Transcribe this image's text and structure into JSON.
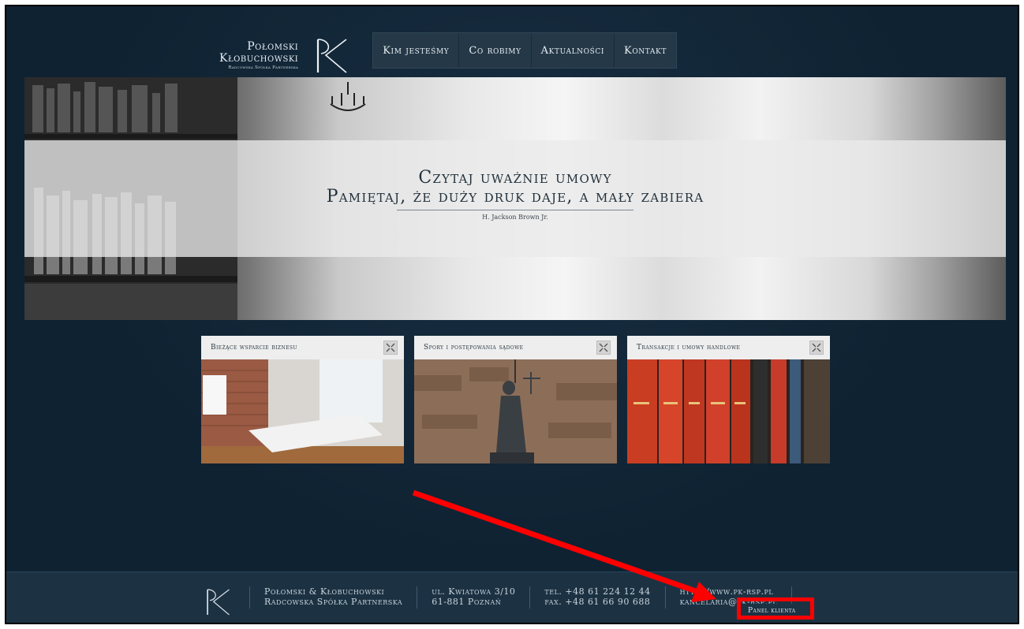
{
  "logo": {
    "line1": "Połomski",
    "line2": "Kłobuchowski",
    "line3": "Radcowska Spółka Partnerska",
    "mark_icon": "pk-monogram-icon"
  },
  "nav": {
    "items": [
      "Kim jesteśmy",
      "Co robimy",
      "Aktualności",
      "Kontakt"
    ]
  },
  "hero": {
    "quote_line1": "Czytaj uważnie umowy",
    "quote_line2": "Pamiętaj, że duży druk daje, a mały zabiera",
    "author": "H. Jackson Brown Jr."
  },
  "cards": [
    {
      "title": "Bieżące wsparcie biznesu",
      "image": "conference-room-photo"
    },
    {
      "title": "Spory i postępowania sądowe",
      "image": "lady-justice-photo"
    },
    {
      "title": "Transakcje i umowy handlowe",
      "image": "law-books-photo"
    }
  ],
  "footer": {
    "firm_line1": "Połomski & Kłobuchowski",
    "firm_line2": "Radcowska Spółka Partnerska",
    "address_line1": "ul. Kwiatowa 3/10",
    "address_line2": "61-881 Poznań",
    "phone": "tel. +48 61 224 12 44",
    "fax": "fax. +48 61 66 90 688",
    "website": "http://www.pk-rsp.pl",
    "email": "kancelaria@pk-rsp.pl",
    "panel_label": "Panel klienta"
  },
  "annotation": {
    "arrow_color": "#ff0000",
    "box_color": "#ff0000"
  }
}
